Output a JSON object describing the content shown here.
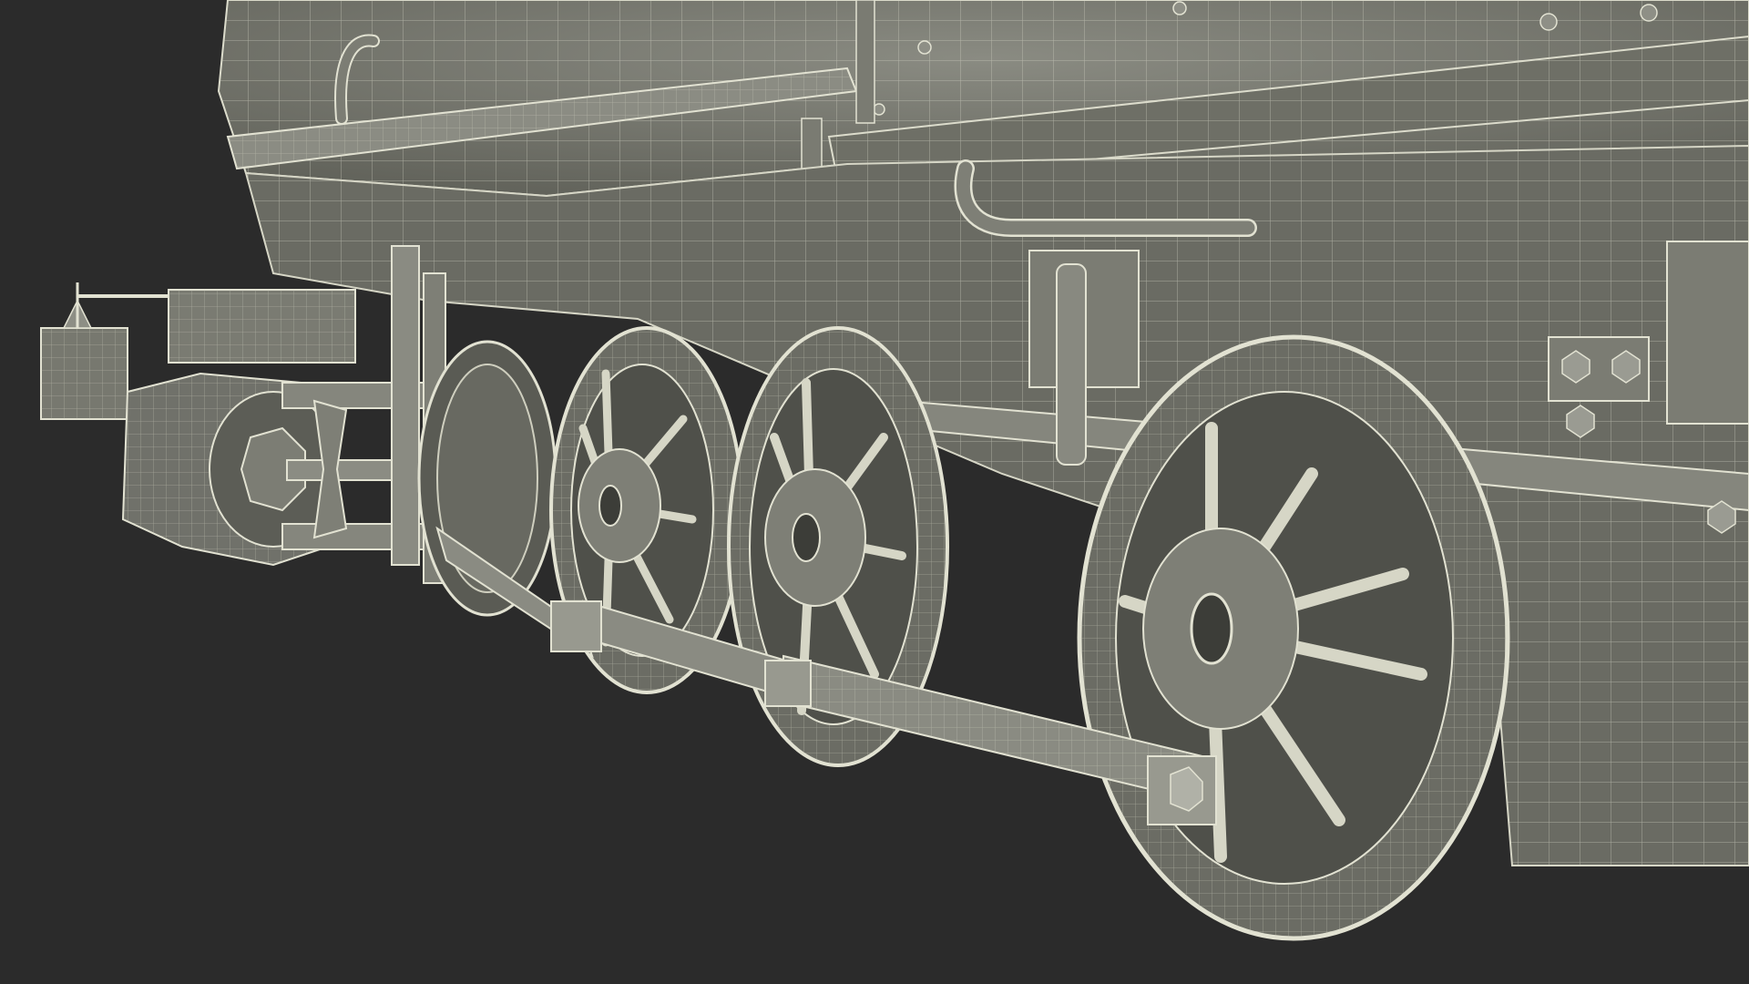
{
  "scene": {
    "subject": "steam-locomotive-wireframe-render",
    "background_color": "#2b2b2b",
    "model_fill_color": "#77786f",
    "model_dark_color": "#5e5f57",
    "wire_color": "#d8d8c8"
  }
}
